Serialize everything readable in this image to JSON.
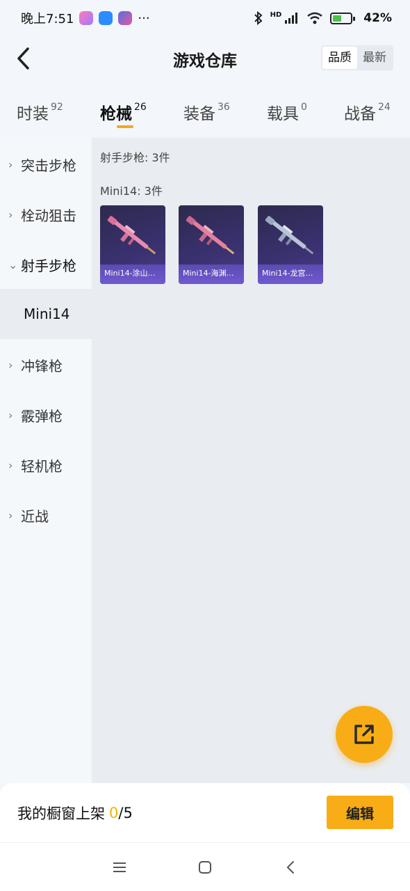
{
  "status_bar": {
    "time": "晚上7:51",
    "more": "···",
    "network": "HD",
    "battery": "42%",
    "battery_level": 0.42
  },
  "header": {
    "title": "游戏仓库",
    "sort_options": [
      "品质",
      "最新"
    ],
    "sort_selected": "品质"
  },
  "tabs": [
    {
      "label": "时装",
      "count": "92"
    },
    {
      "label": "枪械",
      "count": "26"
    },
    {
      "label": "装备",
      "count": "36"
    },
    {
      "label": "载具",
      "count": "0"
    },
    {
      "label": "战备",
      "count": "24"
    }
  ],
  "active_tab": "枪械",
  "sidebar": {
    "items": [
      {
        "label": "突击步枪"
      },
      {
        "label": "栓动狙击"
      },
      {
        "label": "射手步枪"
      },
      {
        "label": "冲锋枪"
      },
      {
        "label": "霰弹枪"
      },
      {
        "label": "轻机枪"
      },
      {
        "label": "近战"
      }
    ],
    "expanded": "射手步枪",
    "selected_sub": "Mini14"
  },
  "main": {
    "category_title": "射手步枪: 3件",
    "group_title": "Mini14: 3件",
    "items": [
      {
        "name": "Mini14-涂山…",
        "color": "#e98ab0"
      },
      {
        "name": "Mini14-海渊…",
        "color": "#e4809f"
      },
      {
        "name": "Mini14-龙宫…",
        "color": "#b9c4d6"
      }
    ]
  },
  "bottom": {
    "shelf_label": "我的橱窗上架",
    "shelf_count": "0",
    "shelf_total": "/5",
    "edit_label": "编辑"
  },
  "colors": {
    "accent": "#f8ad17",
    "card_bg": "#3a3170"
  }
}
